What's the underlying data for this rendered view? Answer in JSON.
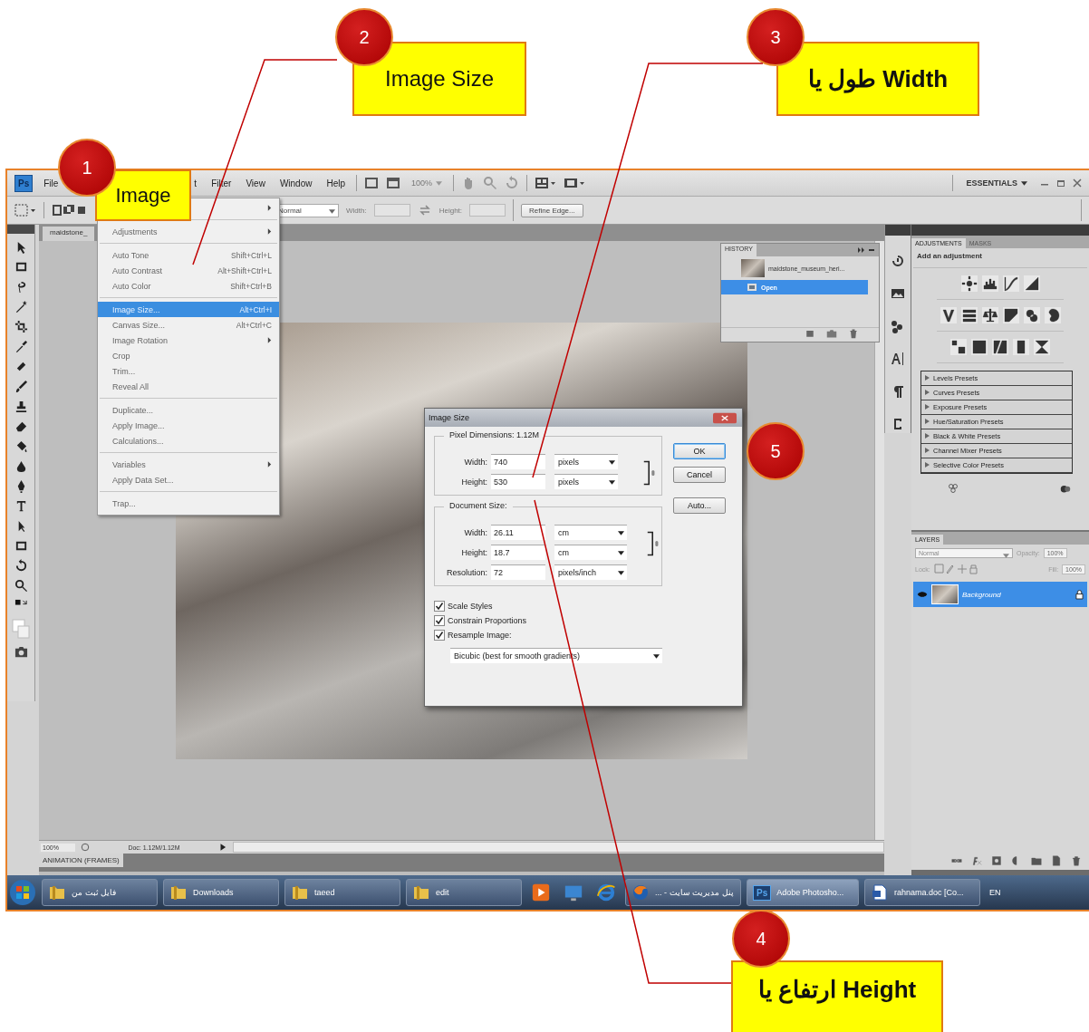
{
  "annotations": [
    {
      "number": "1",
      "label": "Image"
    },
    {
      "number": "2",
      "label": "Image Size"
    },
    {
      "number": "3",
      "label": "طول یا Width"
    },
    {
      "number": "4",
      "label": "ارتفاع یا Height"
    },
    {
      "number": "5"
    }
  ],
  "menu_bar": {
    "logo": "Ps",
    "items": [
      "File",
      "t",
      "Filter",
      "View",
      "Window",
      "Help"
    ],
    "zoom": "100%",
    "workspace": "ESSENTIALS"
  },
  "options_bar": {
    "style": "Normal",
    "width_label": "Width:",
    "height_label": "Height:",
    "refine_button": "Refine Edge..."
  },
  "document": {
    "tab": "maidstone_"
  },
  "image_menu": {
    "groups": [
      [
        {
          "submenu": true,
          "selected": false
        }
      ],
      [
        {
          "label": "Adjustments",
          "submenu": true,
          "selected": false
        }
      ],
      [
        {
          "label": "Auto Tone",
          "shortcut": "Shift+Ctrl+L",
          "submenu": false,
          "selected": false
        },
        {
          "label": "Auto Contrast",
          "shortcut": "Alt+Shift+Ctrl+L",
          "submenu": false,
          "selected": false
        },
        {
          "label": "Auto Color",
          "shortcut": "Shift+Ctrl+B",
          "submenu": false,
          "selected": false
        }
      ],
      [
        {
          "label": "Image Size...",
          "shortcut": "Alt+Ctrl+I",
          "submenu": false,
          "selected": true
        },
        {
          "label": "Canvas Size...",
          "shortcut": "Alt+Ctrl+C",
          "submenu": false,
          "selected": false
        },
        {
          "label": "Image Rotation",
          "submenu": true,
          "selected": false
        },
        {
          "label": "Crop",
          "submenu": false,
          "selected": false
        },
        {
          "label": "Trim...",
          "submenu": false,
          "selected": false
        },
        {
          "label": "Reveal All",
          "submenu": false,
          "selected": false
        }
      ],
      [
        {
          "label": "Duplicate...",
          "submenu": false,
          "selected": false
        },
        {
          "label": "Apply Image...",
          "submenu": false,
          "selected": false
        },
        {
          "label": "Calculations...",
          "submenu": false,
          "selected": false
        }
      ],
      [
        {
          "label": "Variables",
          "submenu": true,
          "selected": false
        },
        {
          "label": "Apply Data Set...",
          "submenu": false,
          "selected": false
        }
      ],
      [
        {
          "label": "Trap...",
          "submenu": false,
          "selected": false
        }
      ]
    ]
  },
  "history": {
    "title": "HISTORY",
    "items": [
      {
        "label": "maidstone_museum_heri...",
        "kind": "snapshot",
        "selected": false
      },
      {
        "label": "Open",
        "kind": "step",
        "selected": true
      }
    ]
  },
  "dialog": {
    "title": "Image Size",
    "pixel_dimensions": {
      "label": "Pixel Dimensions:",
      "value": "1.12M",
      "fields": [
        {
          "label": "Width:",
          "value": "740",
          "unit": "pixels"
        },
        {
          "label": "Height:",
          "value": "530",
          "unit": "pixels"
        }
      ]
    },
    "document_size": {
      "label": "Document Size:",
      "fields": [
        {
          "label": "Width:",
          "value": "26.11",
          "unit": "cm"
        },
        {
          "label": "Height:",
          "value": "18.7",
          "unit": "cm"
        },
        {
          "label": "Resolution:",
          "value": "72",
          "unit": "pixels/inch"
        }
      ]
    },
    "checkboxes": [
      {
        "label": "Scale Styles",
        "checked": true
      },
      {
        "label": "Constrain Proportions",
        "checked": true
      },
      {
        "label": "Resample Image:",
        "checked": true
      }
    ],
    "resample_method": "Bicubic (best for smooth gradients)",
    "buttons": [
      {
        "label": "OK",
        "default": true
      },
      {
        "label": "Cancel",
        "default": false
      },
      {
        "label": "Auto...",
        "default": false
      }
    ]
  },
  "adjustments_panel": {
    "tabs": [
      {
        "label": "ADJUSTMENTS",
        "selected": true
      },
      {
        "label": "MASKS",
        "selected": false
      }
    ],
    "heading": "Add an adjustment",
    "presets": [
      "Levels Presets",
      "Curves Presets",
      "Exposure Presets",
      "Hue/Saturation Presets",
      "Black & White Presets",
      "Channel Mixer Presets",
      "Selective Color Presets"
    ]
  },
  "layers_panel": {
    "title": "LAYERS",
    "blend_mode": "Normal",
    "opacity_label": "Opacity:",
    "opacity": "100%",
    "lock_label": "Lock:",
    "fill_label": "Fill:",
    "fill": "100%",
    "layers": [
      {
        "name": "Background",
        "selected": true
      }
    ]
  },
  "status_bar": {
    "zoom": "100%",
    "doc_info": "Doc: 1.12M/1.12M"
  },
  "animation_panel": {
    "title": "ANIMATION (FRAMES)"
  },
  "taskbar": {
    "buttons": [
      {
        "label": "فایل ثبت من",
        "kind": "folder"
      },
      {
        "label": "Downloads",
        "kind": "folder"
      },
      {
        "label": "taeed",
        "kind": "folder"
      },
      {
        "label": "edit",
        "kind": "folder"
      },
      {
        "label": "... - پنل مدیریت سایت",
        "kind": "browser"
      },
      {
        "label": "Adobe Photosho...",
        "kind": "photoshop",
        "icon_text": "Ps"
      },
      {
        "label": "rahnama.doc [Co...",
        "kind": "document"
      }
    ],
    "language": "EN"
  }
}
